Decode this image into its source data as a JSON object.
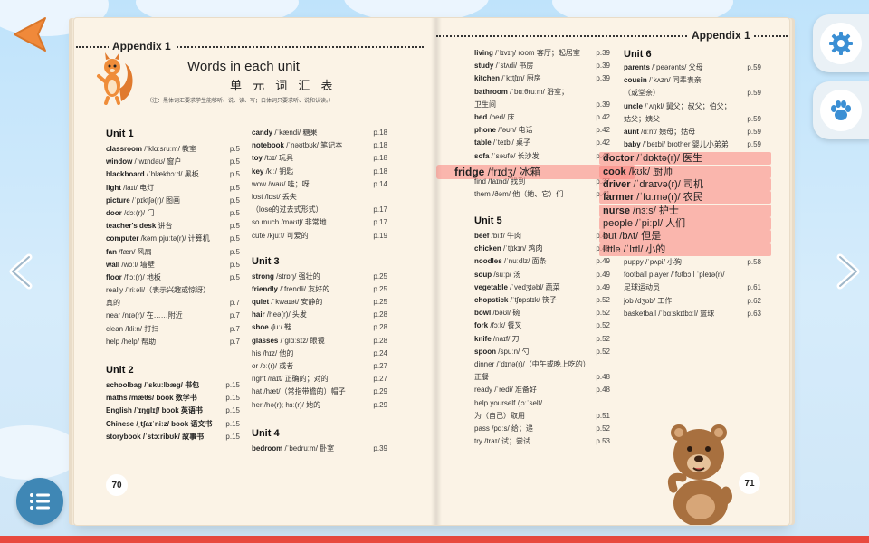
{
  "header": {
    "appendix_label": "Appendix 1"
  },
  "title": {
    "en": "Words in each unit",
    "cn": "单 元 词 汇 表",
    "note": "（注：黑体词汇要求学生能够听、说、读、写；白体词只要求听、说和认读。）"
  },
  "pages": {
    "left_number": "70",
    "right_number": "71"
  },
  "left_col1": {
    "unit1_heading": "Unit 1",
    "unit1": [
      {
        "word": "classroom",
        "phonetic": " /ˈklɑːsruːm/ 教室",
        "page": "p.5"
      },
      {
        "word": "window",
        "phonetic": " /ˈwɪndəʊ/ 窗户",
        "page": "p.5"
      },
      {
        "word": "blackboard",
        "phonetic": " /ˈblækbɔːd/ 黑板",
        "page": "p.5"
      },
      {
        "word": "light",
        "phonetic": " /laɪt/ 电灯",
        "page": "p.5"
      },
      {
        "word": "picture",
        "phonetic": " /ˈpɪktʃə(r)/ 图画",
        "page": "p.5"
      },
      {
        "word": "door",
        "phonetic": " /dɔː(r)/ 门",
        "page": "p.5"
      },
      {
        "word": "teacher's desk",
        "phonetic": " 讲台",
        "page": "p.5"
      },
      {
        "word": "computer",
        "phonetic": " /kəmˈpjuːtə(r)/ 计算机",
        "page": "p.5"
      },
      {
        "word": "fan",
        "phonetic": " /fæn/ 风扇",
        "page": "p.5"
      },
      {
        "word": "wall",
        "phonetic": " /wɔːl/ 墙壁",
        "page": "p.5"
      },
      {
        "word": "floor",
        "phonetic": " /flɔː(r)/ 地板",
        "page": "p.5"
      },
      {
        "word": "",
        "phonetic": "really /ˈriːəli/（表示兴趣或惊讶）",
        "page": ""
      },
      {
        "word": "",
        "phonetic": "真的",
        "page": "p.7"
      },
      {
        "word": "",
        "phonetic": "near /nɪə(r)/ 在……附近",
        "page": "p.7"
      },
      {
        "word": "",
        "phonetic": "clean /kliːn/ 打扫",
        "page": "p.7"
      },
      {
        "word": "",
        "phonetic": "help /help/ 帮助",
        "page": "p.7"
      }
    ],
    "unit2_heading": "Unit 2",
    "unit2": [
      {
        "word": "",
        "phonetic": "schoolbag /ˈskuːlbæg/ 书包",
        "page": "p.15"
      },
      {
        "word": "",
        "phonetic": "maths /mæθs/ book 数学书",
        "page": "p.15"
      },
      {
        "word": "",
        "phonetic": "English /ˈɪŋglɪʃ/ book 英语书",
        "page": "p.15"
      },
      {
        "word": "",
        "phonetic": "Chinese /ˌtʃaɪˈniːz/ book 语文书",
        "page": "p.15"
      },
      {
        "word": "",
        "phonetic": "storybook /ˈstɔːribʊk/ 故事书",
        "page": "p.15"
      }
    ]
  },
  "left_col2": {
    "top": [
      {
        "word": "candy",
        "phonetic": " /ˈkændi/ 糖果",
        "page": "p.18"
      },
      {
        "word": "notebook",
        "phonetic": " /ˈnəʊtbʊk/ 笔记本",
        "page": "p.18"
      },
      {
        "word": "toy",
        "phonetic": " /tɔɪ/ 玩具",
        "page": "p.18"
      },
      {
        "word": "key",
        "phonetic": " /kiː/ 钥匙",
        "page": "p.18"
      },
      {
        "word": "",
        "phonetic": "wow /waʊ/ 哇；呀",
        "page": "p.14"
      },
      {
        "word": "",
        "phonetic": "lost /lɒst/ 丢失",
        "page": ""
      },
      {
        "word": "",
        "phonetic": "（lose的过去式形式）",
        "page": "p.17"
      },
      {
        "word": "",
        "phonetic": "so much /məʊtʃ/ 非常地",
        "page": "p.17"
      },
      {
        "word": "",
        "phonetic": "cute /kjuːt/ 可爱的",
        "page": "p.19"
      }
    ],
    "unit3_heading": "Unit 3",
    "unit3": [
      {
        "word": "strong",
        "phonetic": " /strɒŋ/ 强壮的",
        "page": "p.25"
      },
      {
        "word": "friendly",
        "phonetic": " /ˈfrendli/ 友好的",
        "page": "p.25"
      },
      {
        "word": "quiet",
        "phonetic": " /ˈkwaɪət/ 安静的",
        "page": "p.25"
      },
      {
        "word": "hair",
        "phonetic": " /heə(r)/ 头发",
        "page": "p.28"
      },
      {
        "word": "shoe",
        "phonetic": " /ʃuː/ 鞋",
        "page": "p.28"
      },
      {
        "word": "glasses",
        "phonetic": " /ˈglɑːsɪz/ 眼镜",
        "page": "p.28"
      },
      {
        "word": "",
        "phonetic": "his /hɪz/ 他的",
        "page": "p.24"
      },
      {
        "word": "",
        "phonetic": "or /ɔː(r)/ 或者",
        "page": "p.27"
      },
      {
        "word": "",
        "phonetic": "right /raɪt/ 正确的；对的",
        "page": "p.27"
      },
      {
        "word": "",
        "phonetic": "hat /hæt/（常指带檐的）帽子",
        "page": "p.29"
      },
      {
        "word": "",
        "phonetic": "her /hə(r); hɜː(r)/ 她的",
        "page": "p.29"
      }
    ],
    "unit4_heading": "Unit 4",
    "unit4": [
      {
        "word": "bedroom",
        "phonetic": " /ˈbedruːm/ 卧室",
        "page": "p.39"
      }
    ]
  },
  "right_col1": {
    "top": [
      {
        "word": "living",
        "phonetic": " /ˈlɪvɪŋ/ room 客厅；起居室",
        "page": "p.39"
      },
      {
        "word": "study",
        "phonetic": " /ˈstʌdi/ 书房",
        "page": "p.39"
      },
      {
        "word": "kitchen",
        "phonetic": " /ˈkɪtʃɪn/ 厨房",
        "page": "p.39"
      },
      {
        "word": "bathroom",
        "phonetic": " /ˈbɑːθruːm/ 浴室；",
        "page": ""
      },
      {
        "word": "",
        "phonetic": "卫生间",
        "page": "p.39"
      },
      {
        "word": "bed",
        "phonetic": " /bed/ 床",
        "page": "p.42"
      },
      {
        "word": "phone",
        "phonetic": " /fəʊn/ 电话",
        "page": "p.42"
      },
      {
        "word": "table",
        "phonetic": " /ˈteɪbl/ 桌子",
        "page": "p.42"
      },
      {
        "word": "sofa",
        "phonetic": " /ˈsəʊfə/ 长沙发",
        "page": "p.42"
      }
    ],
    "after": [
      {
        "word": "",
        "phonetic": "find /faɪnd/ 找到",
        "page": "p.37"
      },
      {
        "word": "",
        "phonetic": "them /ðəm/ 他（她、它）们",
        "page": "p.41"
      }
    ],
    "unit5_heading": "Unit 5",
    "unit5": [
      {
        "word": "beef",
        "phonetic": " /biːf/ 牛肉",
        "page": "p.49"
      },
      {
        "word": "chicken",
        "phonetic": " /ˈtʃɪkɪn/ 鸡肉",
        "page": "p.49"
      },
      {
        "word": "noodles",
        "phonetic": " /ˈnuːdlz/ 面条",
        "page": "p.49"
      },
      {
        "word": "soup",
        "phonetic": " /suːp/ 汤",
        "page": "p.49"
      },
      {
        "word": "vegetable",
        "phonetic": " /ˈvedʒtəbl/ 蔬菜",
        "page": "p.49"
      },
      {
        "word": "chopstick",
        "phonetic": " /ˈtʃɒpstɪk/ 筷子",
        "page": "p.52"
      },
      {
        "word": "bowl",
        "phonetic": " /bəʊl/ 碗",
        "page": "p.52"
      },
      {
        "word": "fork",
        "phonetic": " /fɔːk/ 餐叉",
        "page": "p.52"
      },
      {
        "word": "knife",
        "phonetic": " /naɪf/ 刀",
        "page": "p.52"
      },
      {
        "word": "spoon",
        "phonetic": " /spuːn/ 勺",
        "page": "p.52"
      },
      {
        "word": "",
        "phonetic": "dinner /ˈdɪnə(r)/（中午或晚上吃的）",
        "page": ""
      },
      {
        "word": "",
        "phonetic": "正餐",
        "page": "p.48"
      },
      {
        "word": "",
        "phonetic": "ready /ˈredi/ 准备好",
        "page": "p.48"
      },
      {
        "word": "",
        "phonetic": "help yourself /jɔːˈself/",
        "page": ""
      },
      {
        "word": "",
        "phonetic": "为（自己）取用",
        "page": "p.51"
      },
      {
        "word": "",
        "phonetic": "pass /pɑːs/ 给；递",
        "page": "p.52"
      },
      {
        "word": "",
        "phonetic": "try /traɪ/ 试；尝试",
        "page": "p.53"
      }
    ]
  },
  "right_col2": {
    "unit6_heading": "Unit 6",
    "top": [
      {
        "word": "parents",
        "phonetic": " /ˈpeərənts/ 父母",
        "page": "p.59"
      },
      {
        "word": "cousin",
        "phonetic": " /ˈkʌzn/ 同辈表亲",
        "page": ""
      },
      {
        "word": "",
        "phonetic": "（或堂亲）",
        "page": "p.59"
      },
      {
        "word": "uncle",
        "phonetic": " /ˈʌŋkl/ 舅父；叔父；伯父；",
        "page": ""
      },
      {
        "word": "",
        "phonetic": "姑父；姨父",
        "page": "p.59"
      },
      {
        "word": "aunt",
        "phonetic": " /ɑːnt/ 姨母；姑母",
        "page": "p.59"
      },
      {
        "word": "baby",
        "phonetic": " /ˈbeɪbi/ brother 婴儿小弟弟",
        "page": "p.59"
      }
    ],
    "bottom": [
      {
        "word": "",
        "phonetic": "puppy /ˈpʌpi/ 小狗",
        "page": "p.58"
      },
      {
        "word": "",
        "phonetic": "football player /ˈfʊtbɔːl ˈpleɪə(r)/",
        "page": ""
      },
      {
        "word": "",
        "phonetic": "足球运动员",
        "page": "p.61"
      },
      {
        "word": "",
        "phonetic": "job /dʒɒb/ 工作",
        "page": "p.62"
      },
      {
        "word": "",
        "phonetic": "basketball /ˈbɑːskɪtbɔːl/ 篮球",
        "page": "p.63"
      }
    ]
  },
  "highlights": {
    "fridge": {
      "word": "fridge",
      "rest": " /frɪdʒ/ 冰箱"
    },
    "items": [
      {
        "word": "doctor",
        "rest": " /ˈdɒktə(r)/ 医生"
      },
      {
        "word": "cook",
        "rest": " /kʊk/ 厨师"
      },
      {
        "word": "driver",
        "rest": " /ˈdraɪvə(r)/ 司机"
      },
      {
        "word": "farmer",
        "rest": " /ˈfɑːmə(r)/ 农民"
      },
      {
        "word": "nurse",
        "rest": " /nɜːs/ 护士"
      },
      {
        "word": "",
        "rest": "people /ˈpiːpl/ 人们"
      },
      {
        "word": "",
        "rest": "but /bʌt/ 但是"
      },
      {
        "word": "",
        "rest": "little /ˈlɪtl/ 小的"
      }
    ]
  },
  "icons": {
    "back": "back-arrow-icon",
    "settings": "gear-icon",
    "paw": "paw-icon",
    "menu": "list-icon",
    "prev": "chevron-left-icon",
    "next": "chevron-right-icon"
  },
  "colors": {
    "accent": "#f0893a",
    "highlight": "#fa847e",
    "bottom_bar": "#e84a3f",
    "menu_button": "#3f87b5"
  }
}
